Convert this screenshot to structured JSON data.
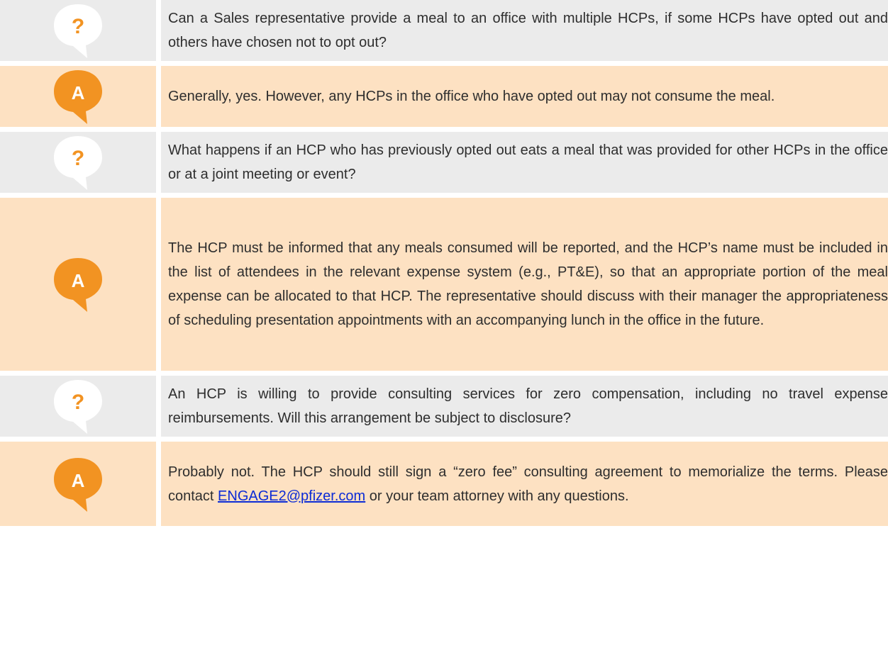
{
  "colors": {
    "question_bg": "#ebebeb",
    "answer_bg": "#fde1c2",
    "accent_orange": "#f29322",
    "link_blue": "#0b2bd6"
  },
  "icons": {
    "question": "question-bubble-icon",
    "answer": "answer-bubble-icon",
    "question_glyph": "?",
    "answer_glyph": "A"
  },
  "faq": [
    {
      "type": "question",
      "text": "Can a Sales representative provide a meal to an office with multiple HCPs, if some HCPs have opted out and others have chosen not to opt out?"
    },
    {
      "type": "answer",
      "text": "Generally, yes. However, any HCPs in the office who have opted out may not consume the meal."
    },
    {
      "type": "question",
      "text": "What happens if an HCP who has previously opted out eats a meal that was provided for other HCPs in the office or at a joint meeting or event?"
    },
    {
      "type": "answer",
      "text": "The HCP must be informed that any meals consumed will be reported, and the HCP’s name must be included in the list of attendees in the relevant expense system (e.g., PT&E), so that an appropriate portion of the meal expense can be allocated to that HCP. The representative should discuss with their manager the appropriateness of scheduling presentation appointments with an accompanying lunch in the office in the future."
    },
    {
      "type": "question",
      "text": "An HCP is willing to provide consulting services for zero compensation, including no travel expense reimbursements. Will this arrangement be subject to disclosure?"
    },
    {
      "type": "answer",
      "text_before": "Probably not. The HCP should still sign a “zero fee” consulting agreement to memorialize the terms. Please contact ",
      "link_text": "ENGAGE2@pfizer.com",
      "text_after": " or your team attorney with any questions."
    }
  ]
}
